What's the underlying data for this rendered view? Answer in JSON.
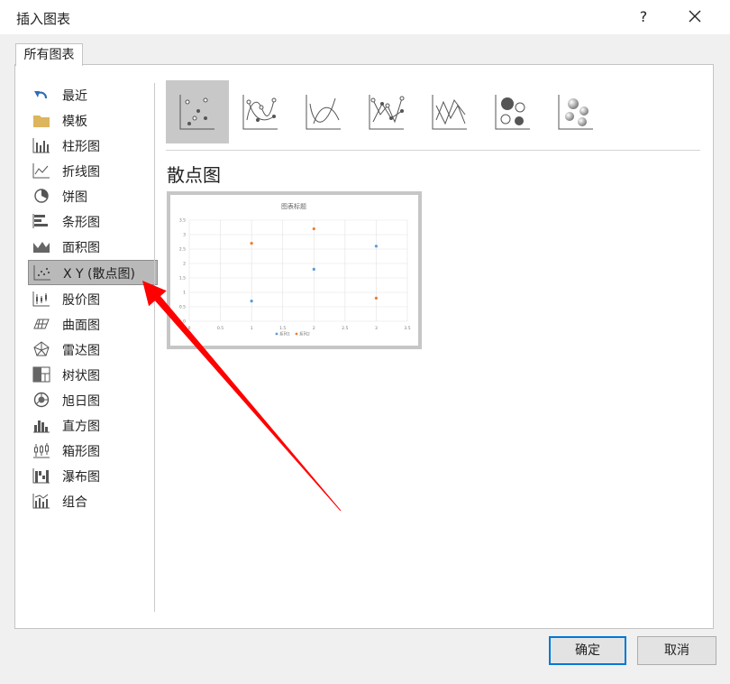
{
  "dialog": {
    "title": "插入图表",
    "help": "?"
  },
  "tab": {
    "label": "所有图表"
  },
  "categories": [
    {
      "label": "最近"
    },
    {
      "label": "模板"
    },
    {
      "label": "柱形图"
    },
    {
      "label": "折线图"
    },
    {
      "label": "饼图"
    },
    {
      "label": "条形图"
    },
    {
      "label": "面积图"
    },
    {
      "label": "X Y (散点图)"
    },
    {
      "label": "股价图"
    },
    {
      "label": "曲面图"
    },
    {
      "label": "雷达图"
    },
    {
      "label": "树状图"
    },
    {
      "label": "旭日图"
    },
    {
      "label": "直方图"
    },
    {
      "label": "箱形图"
    },
    {
      "label": "瀑布图"
    },
    {
      "label": "组合"
    }
  ],
  "selected_category": "X Y (散点图)",
  "subtype": {
    "title": "散点图"
  },
  "preview": {
    "chart_data": {
      "type": "scatter",
      "title": "图表标题",
      "xlim": [
        0,
        3.5
      ],
      "ylim": [
        0,
        3.5
      ],
      "x_ticks": [
        "0",
        "0.5",
        "1",
        "1.5",
        "2",
        "2.5",
        "3",
        "3.5"
      ],
      "y_ticks": [
        "0",
        "0.5",
        "1",
        "1.5",
        "2",
        "2.5",
        "3",
        "3.5"
      ],
      "grid": true,
      "legend_position": "bottom",
      "colors": [
        "#5b9bd5",
        "#ed7d31"
      ],
      "series": [
        {
          "name": "系列1",
          "points": [
            [
              1,
              0.7
            ],
            [
              2,
              1.8
            ],
            [
              3,
              2.6
            ]
          ]
        },
        {
          "name": "系列2",
          "points": [
            [
              1,
              2.7
            ],
            [
              2,
              3.2
            ],
            [
              3,
              0.8
            ]
          ]
        }
      ]
    }
  },
  "buttons": {
    "ok": "确定",
    "cancel": "取消"
  },
  "annotation": {
    "arrow_color": "#ff0000"
  }
}
